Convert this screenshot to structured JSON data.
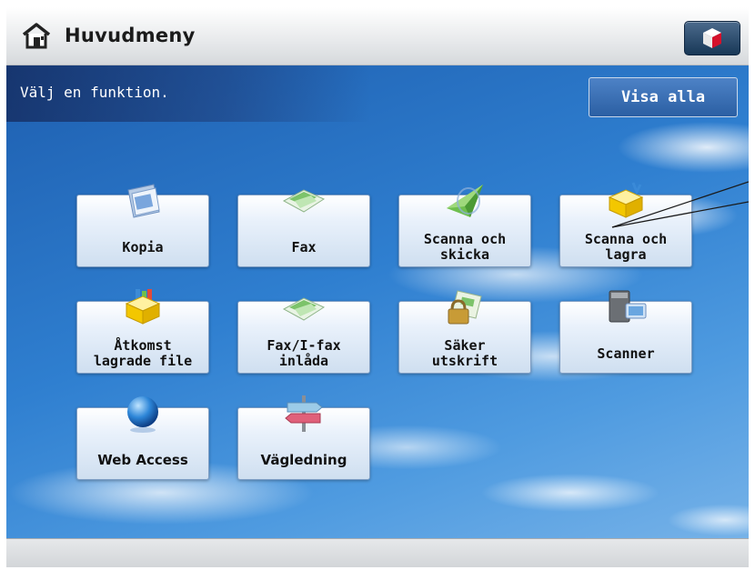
{
  "header": {
    "title": "Huvudmeny",
    "home_icon": "home-icon",
    "system_icon": "cube-icon"
  },
  "main": {
    "prompt": "Välj en funktion.",
    "show_all_label": "Visa alla"
  },
  "functions": [
    {
      "label": "Kopia",
      "icon": "copy-icon"
    },
    {
      "label": "Fax",
      "icon": "fax-icon"
    },
    {
      "label": "Scanna och\nskicka",
      "icon": "scan-send-icon"
    },
    {
      "label": "Scanna och\nlagra",
      "icon": "scan-store-icon"
    },
    {
      "label": "Åtkomst\nlagrade file",
      "icon": "stored-files-icon"
    },
    {
      "label": "Fax/I-fax\ninlåda",
      "icon": "fax-inbox-icon"
    },
    {
      "label": "Säker\nutskrift",
      "icon": "secure-print-icon"
    },
    {
      "label": "Scanner",
      "icon": "scanner-icon"
    },
    {
      "label": "Web Access",
      "icon": "web-access-icon"
    },
    {
      "label": "Vägledning",
      "icon": "guide-icon"
    }
  ],
  "colors": {
    "sky": "#2f7fd0",
    "button_border": "#7d9dc4",
    "header_bg": "#e7e9eb"
  }
}
